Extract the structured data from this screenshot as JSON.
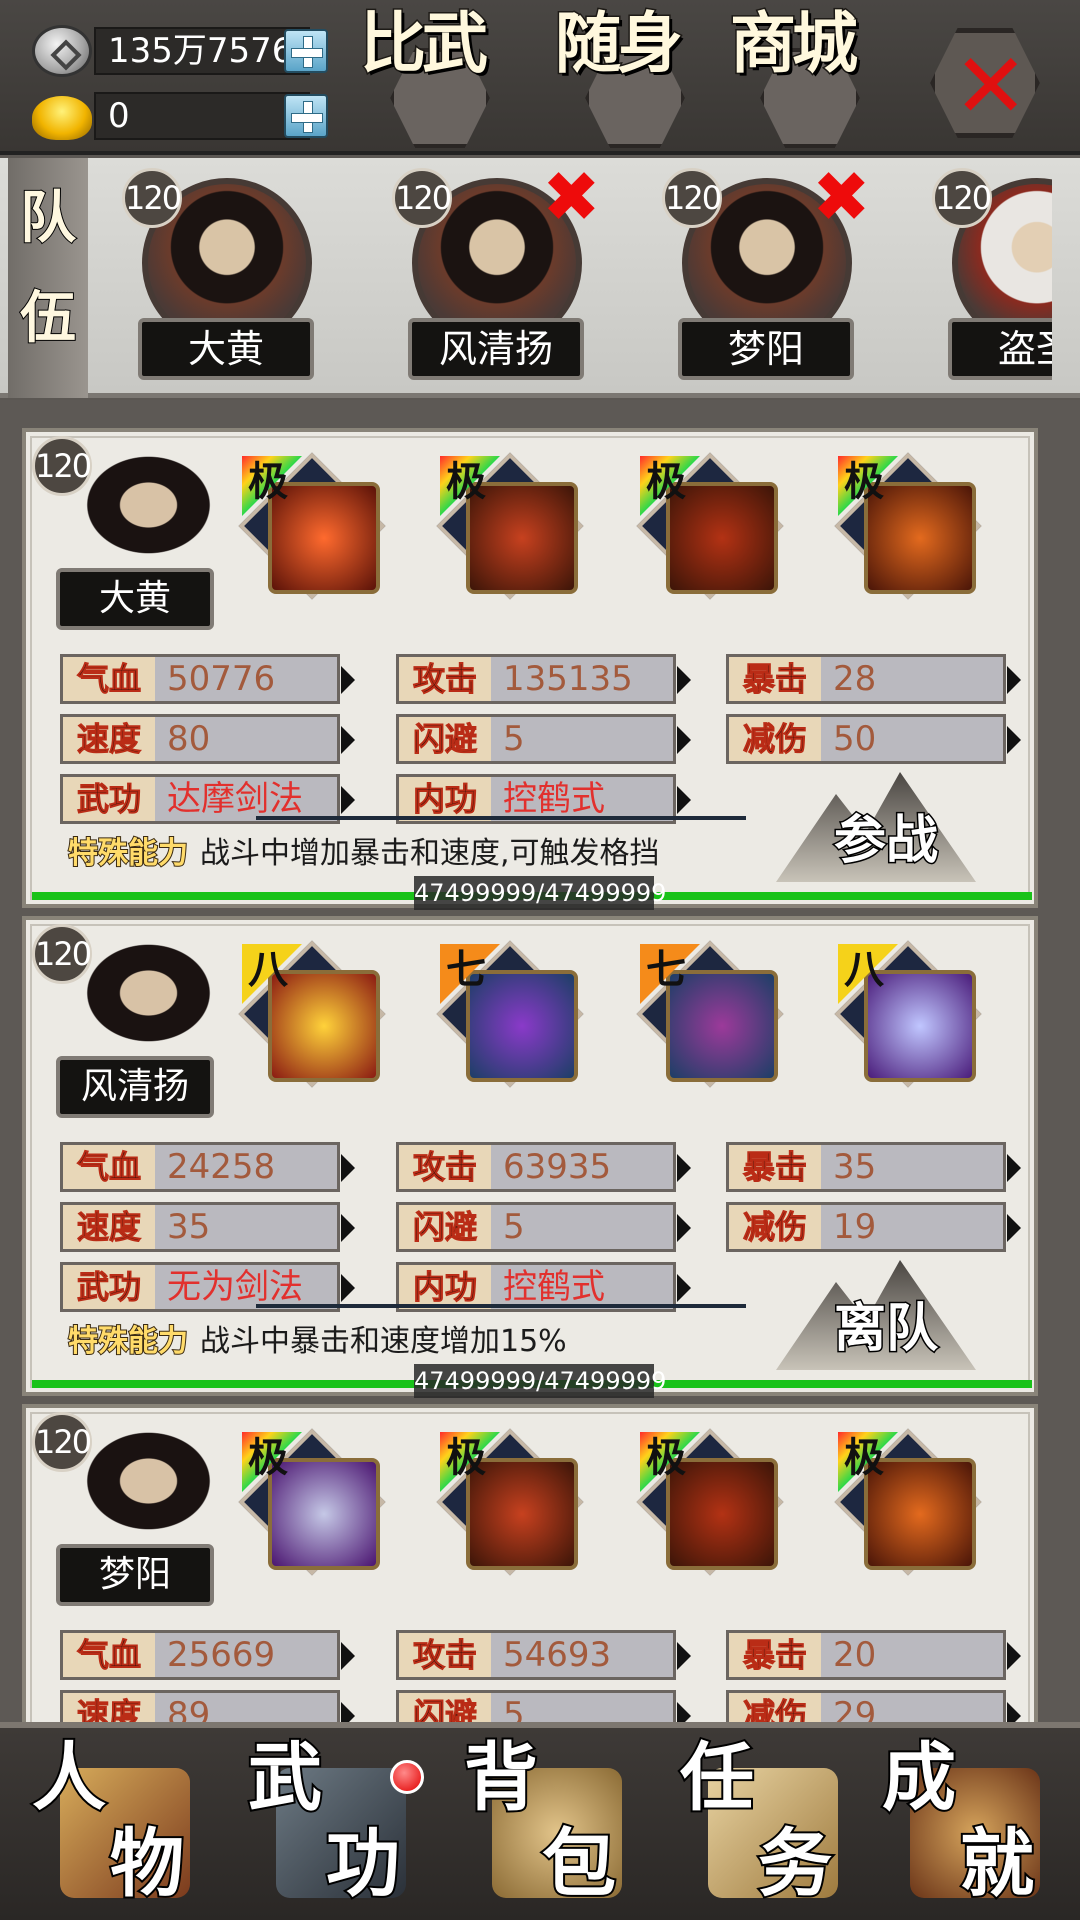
{
  "currency": {
    "silver": "135万7576",
    "gold": "0"
  },
  "top_menu": [
    {
      "label": "比武"
    },
    {
      "label": "随身"
    },
    {
      "label": "商城"
    }
  ],
  "team": {
    "label": "队伍",
    "members": [
      {
        "level": "120",
        "name": "大黄",
        "removable": false
      },
      {
        "level": "120",
        "name": "风清扬",
        "removable": true
      },
      {
        "level": "120",
        "name": "梦阳",
        "removable": true
      },
      {
        "level": "120",
        "name": "盗圣",
        "removable": false
      }
    ]
  },
  "heroes": [
    {
      "level": "120",
      "name": "大黄",
      "equipment": [
        {
          "grade": "极",
          "grade_color": "rainbow",
          "item": "sword-icon"
        },
        {
          "grade": "极",
          "grade_color": "rainbow",
          "item": "armor-icon"
        },
        {
          "grade": "极",
          "grade_color": "rainbow",
          "item": "boots-icon"
        },
        {
          "grade": "极",
          "grade_color": "rainbow",
          "item": "talisman-icon"
        }
      ],
      "stats": {
        "hp_label": "气血",
        "hp": "50776",
        "atk_label": "攻击",
        "atk": "135135",
        "crit_label": "暴击",
        "crit": "28",
        "spd_label": "速度",
        "spd": "80",
        "dodge_label": "闪避",
        "dodge": "5",
        "dmgred_label": "减伤",
        "dmgred": "50",
        "martial_label": "武功",
        "martial": "达摩剑法",
        "inner_label": "内功",
        "inner": "控鹤式"
      },
      "special_label": "特殊能力",
      "special": "战斗中增加暴击和速度,可触发格挡",
      "action": "参战",
      "hp_bar": "47499999/47499999",
      "hp_fraction": 1.0
    },
    {
      "level": "120",
      "name": "风清扬",
      "equipment": [
        {
          "grade": "八",
          "grade_color": "yellow",
          "item": "sword-icon"
        },
        {
          "grade": "七",
          "grade_color": "orange",
          "item": "armor-icon"
        },
        {
          "grade": "七",
          "grade_color": "orange",
          "item": "boots-icon"
        },
        {
          "grade": "八",
          "grade_color": "yellow",
          "item": "ring-icon"
        }
      ],
      "stats": {
        "hp_label": "气血",
        "hp": "24258",
        "atk_label": "攻击",
        "atk": "63935",
        "crit_label": "暴击",
        "crit": "35",
        "spd_label": "速度",
        "spd": "35",
        "dodge_label": "闪避",
        "dodge": "5",
        "dmgred_label": "减伤",
        "dmgred": "19",
        "martial_label": "武功",
        "martial": "无为剑法",
        "inner_label": "内功",
        "inner": "控鹤式"
      },
      "special_label": "特殊能力",
      "special": "战斗中暴击和速度增加15%",
      "action": "离队",
      "hp_bar": "47499999/47499999",
      "hp_fraction": 1.0
    },
    {
      "level": "120",
      "name": "梦阳",
      "equipment": [
        {
          "grade": "极",
          "grade_color": "rainbow",
          "item": "claw-icon"
        },
        {
          "grade": "极",
          "grade_color": "rainbow",
          "item": "armor-icon"
        },
        {
          "grade": "极",
          "grade_color": "rainbow",
          "item": "boots-icon"
        },
        {
          "grade": "极",
          "grade_color": "rainbow",
          "item": "talisman-icon"
        }
      ],
      "stats": {
        "hp_label": "气血",
        "hp": "25669",
        "atk_label": "攻击",
        "atk": "54693",
        "crit_label": "暴击",
        "crit": "20",
        "spd_label": "速度",
        "spd": "89",
        "dodge_label": "闪避",
        "dodge": "5",
        "dmgred_label": "减伤",
        "dmgred": "29"
      }
    }
  ],
  "bottom_nav": [
    {
      "c1": "人",
      "c2": "物"
    },
    {
      "c1": "武",
      "c2": "功"
    },
    {
      "c1": "背",
      "c2": "包"
    },
    {
      "c1": "任",
      "c2": "务"
    },
    {
      "c1": "成",
      "c2": "就"
    }
  ]
}
